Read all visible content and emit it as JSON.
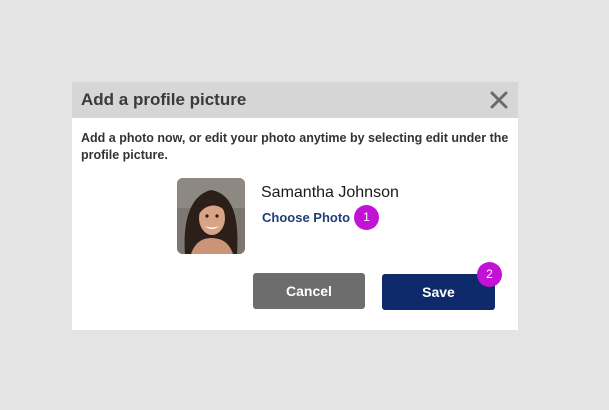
{
  "dialog": {
    "title": "Add a profile picture",
    "close_icon": "close-icon",
    "description": "Add a photo now, or edit your photo anytime by selecting edit under the profile picture."
  },
  "profile": {
    "name": "Samantha Johnson",
    "choose_photo_label": "Choose Photo",
    "avatar": "profile-photo"
  },
  "buttons": {
    "cancel_label": "Cancel",
    "save_label": "Save"
  },
  "step_badges": [
    "1",
    "2"
  ],
  "colors": {
    "header_bg": "#d6d6d6",
    "link": "#1f3e7a",
    "cancel_bg": "#6d6d6d",
    "save_bg": "#0f2a6b",
    "badge": "#c212d6"
  }
}
